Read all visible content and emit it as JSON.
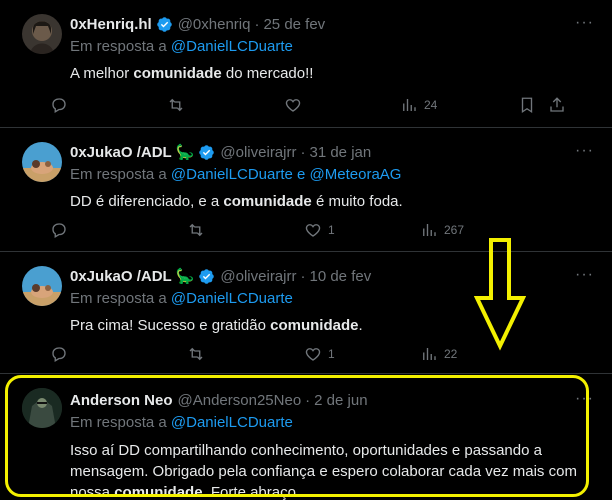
{
  "posts": [
    {
      "name": "0xHenriq.hl",
      "emoji": "",
      "handle": "@0xhenriq",
      "date": "25 de fev",
      "reply_prefix": "Em resposta a",
      "mentions": [
        "@DanielLCDuarte"
      ],
      "text_before": "A melhor ",
      "bold": "comunidade",
      "text_after": " do mercado!!",
      "stats": {
        "reply": "",
        "repost": "",
        "like": "",
        "views": "24"
      }
    },
    {
      "name": "0xJukaO /ADL",
      "emoji": "🦕",
      "handle": "@oliveirajrr",
      "date": "31 de jan",
      "reply_prefix": "Em resposta a",
      "mentions": [
        "@DanielLCDuarte",
        "@MeteoraAG"
      ],
      "mention_joiner": "e",
      "text_before": "DD é diferenciado, e a ",
      "bold": "comunidade",
      "text_after": " é muito foda.",
      "stats": {
        "reply": "",
        "repost": "",
        "like": "1",
        "views": "267"
      }
    },
    {
      "name": "0xJukaO /ADL",
      "emoji": "🦕",
      "handle": "@oliveirajrr",
      "date": "10 de fev",
      "reply_prefix": "Em resposta a",
      "mentions": [
        "@DanielLCDuarte"
      ],
      "text_before": "Pra cima! Sucesso e gratidão ",
      "bold": "comunidade",
      "text_after": ".",
      "stats": {
        "reply": "",
        "repost": "",
        "like": "1",
        "views": "22"
      }
    },
    {
      "name": "Anderson Neo",
      "emoji": "",
      "handle": "@Anderson25Neo",
      "date": "2 de jun",
      "reply_prefix": "Em resposta a",
      "mentions": [
        "@DanielLCDuarte"
      ],
      "text_before": "Isso aí DD compartilhando conhecimento, oportunidades e passando a mensagem. Obrigado pela confiança e espero colaborar cada vez mais com nossa ",
      "bold": "comunidade",
      "text_after": ". Forte abraço."
    }
  ],
  "colors": {
    "background": "#000000",
    "text": "#e7e9ea",
    "muted": "#71767b",
    "link": "#1d9bf0",
    "verified": "#1d9bf0",
    "annotation": "#f3f000"
  },
  "separator_dot": "·",
  "more_label": "···"
}
